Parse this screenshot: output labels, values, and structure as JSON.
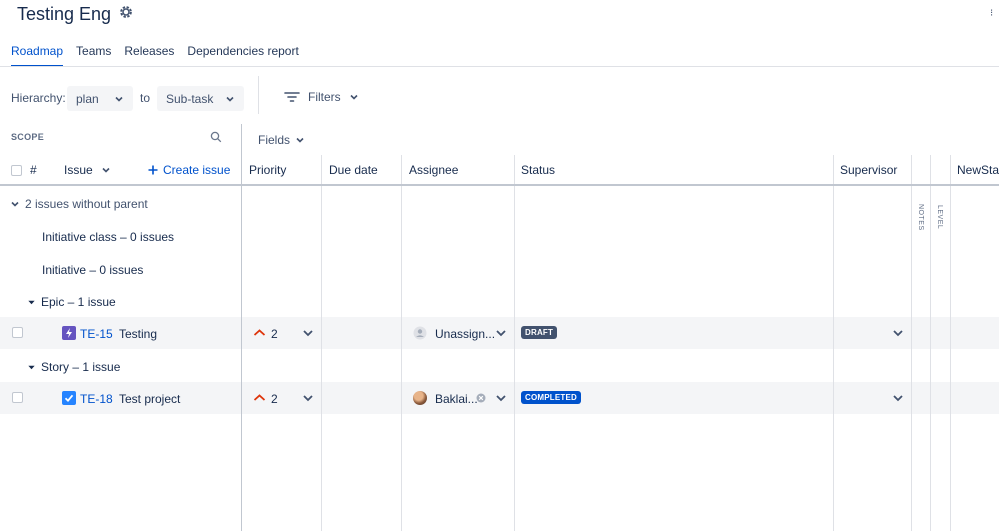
{
  "header": {
    "title": "Testing Eng",
    "settings_icon": "gear-icon",
    "corner_icon": "more-icon"
  },
  "tabs": [
    {
      "label": "Roadmap",
      "active": true
    },
    {
      "label": "Teams",
      "active": false
    },
    {
      "label": "Releases",
      "active": false
    },
    {
      "label": "Dependencies report",
      "active": false
    }
  ],
  "toolbar": {
    "hierarchy_label": "Hierarchy:",
    "from_value": "plan",
    "to_label": "to",
    "to_value": "Sub-task",
    "filters_label": "Filters"
  },
  "scope": {
    "label": "SCOPE",
    "fields_label": "Fields"
  },
  "columns": {
    "number": "#",
    "issue": "Issue",
    "create_issue": "Create issue",
    "priority": "Priority",
    "due_date": "Due date",
    "assignee": "Assignee",
    "status": "Status",
    "supervisor": "Supervisor",
    "notes": "NOTES",
    "level": "LEVEL",
    "newstatus": "NewStat"
  },
  "groups": {
    "no_parent": "2 issues without parent",
    "initiative_class": "Initiative class – 0 issues",
    "initiative": "Initiative – 0 issues",
    "epic": "Epic – 1 issue",
    "story": "Story – 1 issue"
  },
  "issues": [
    {
      "key": "TE-15",
      "summary": "Testing",
      "type_icon": "epic-icon",
      "priority": "2",
      "assignee": "Unassign...",
      "status": "DRAFT",
      "status_color": "#42526e"
    },
    {
      "key": "TE-18",
      "summary": "Test project",
      "type_icon": "story-checkbox-icon",
      "priority": "2",
      "assignee": "Baklai...",
      "status": "COMPLETED",
      "status_color": "#0052cc"
    }
  ],
  "colors": {
    "accent": "#0052cc",
    "priority": "#de350b",
    "epic": "#6554c0"
  }
}
